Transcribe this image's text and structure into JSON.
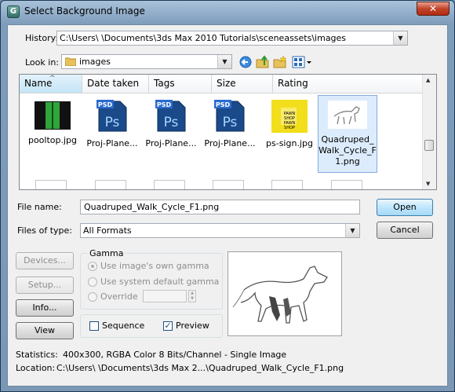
{
  "window": {
    "title": "Select Background Image",
    "close_glyph": "✕"
  },
  "history": {
    "label": "History:",
    "value": "C:\\Users\\          \\Documents\\3ds Max 2010 Tutorials\\sceneassets\\images"
  },
  "look_in": {
    "label": "Look in:",
    "value": "images"
  },
  "toolbar_icons": [
    "back-icon",
    "up-folder-icon",
    "new-folder-icon",
    "view-menu-icon"
  ],
  "columns": [
    {
      "label": "Name",
      "sorted": true
    },
    {
      "label": "Date taken"
    },
    {
      "label": "Tags"
    },
    {
      "label": "Size"
    },
    {
      "label": "Rating"
    }
  ],
  "files": [
    {
      "name": "pooltop.jpg",
      "kind": "image-green"
    },
    {
      "name": "Proj-Plane...",
      "kind": "psd"
    },
    {
      "name": "Proj-Plane...",
      "kind": "psd"
    },
    {
      "name": "Proj-Plane...",
      "kind": "psd"
    },
    {
      "name": "ps-sign.jpg",
      "kind": "image-yellow",
      "sign_text": [
        "PAWN",
        "SHOP",
        "PAWN",
        "SHOP"
      ]
    },
    {
      "name": "Quadruped_Walk_Cycle_F1.png",
      "display_lines": [
        "Quadruped_",
        "Walk_Cycle_F",
        "1.png"
      ],
      "kind": "sketch",
      "selected": true
    }
  ],
  "psd_badge": "PSD",
  "psd_letters": "Ps",
  "file_name": {
    "label": "File name:",
    "value": "Quadruped_Walk_Cycle_F1.png"
  },
  "files_of_type": {
    "label": "Files of type:",
    "value": "All Formats"
  },
  "buttons": {
    "open": "Open",
    "cancel": "Cancel",
    "devices": "Devices...",
    "setup": "Setup...",
    "info": "Info...",
    "view": "View"
  },
  "gamma": {
    "title": "Gamma",
    "options": [
      "Use image's own gamma",
      "Use system default gamma",
      "Override"
    ]
  },
  "sequence_label": "Sequence",
  "preview_label": "Preview",
  "preview_checked": true,
  "statistics": {
    "label": "Statistics:",
    "value": "400x300, RGBA Color 8 Bits/Channel - Single Image"
  },
  "location": {
    "label": "Location:",
    "value": "C:\\Users\\          \\Documents\\3ds Max 2...\\Quadruped_Walk_Cycle_F1.png"
  },
  "colors": {
    "titlebar": "#7e9cbb",
    "selection": "#dcecfc",
    "accent": "#3c7fb1"
  }
}
